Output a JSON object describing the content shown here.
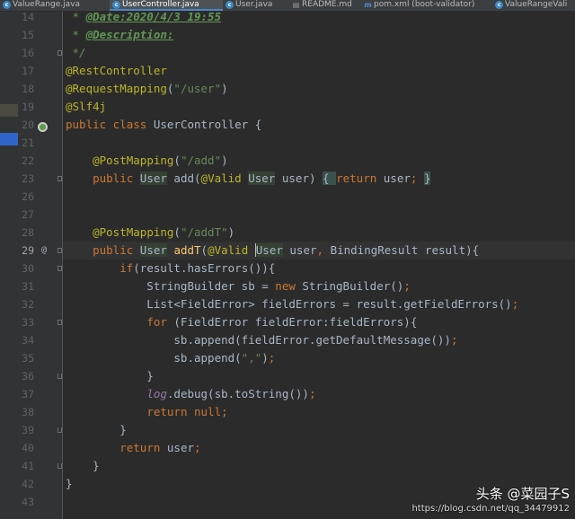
{
  "tabs": [
    {
      "label": "ValueRange.java",
      "icon": "class-icon"
    },
    {
      "label": "UserController.java",
      "icon": "class-icon",
      "active": true
    },
    {
      "label": "User.java",
      "icon": "class-icon"
    },
    {
      "label": "README.md",
      "icon": "markdown-icon"
    },
    {
      "label": "pom.xml (boot-validator)",
      "icon": "maven-icon"
    },
    {
      "label": "ValueRangeVali",
      "icon": "class-icon"
    }
  ],
  "gutter": {
    "line_numbers": [
      "14",
      "15",
      "16",
      "17",
      "18",
      "19",
      "20",
      "21",
      "22",
      "23",
      "26",
      "27",
      "28",
      "29",
      "30",
      "31",
      "32",
      "33",
      "34",
      "35",
      "36",
      "37",
      "38",
      "39",
      "40",
      "41",
      "42",
      "43"
    ],
    "current_line": "29",
    "override_marker": "@"
  },
  "code": {
    "l14": {
      "a": " * ",
      "b": "@Date:2020/4/3 19:55"
    },
    "l15": {
      "a": " * ",
      "b": "@Description:"
    },
    "l16": {
      "a": " */"
    },
    "l17": {
      "a": "@RestController"
    },
    "l18": {
      "a": "@RequestMapping",
      "b": "(",
      "c": "\"/user\"",
      "d": ")"
    },
    "l19": {
      "a": "@Slf4j"
    },
    "l20": {
      "a": "public class ",
      "b": "UserController {"
    },
    "l22": {
      "a": "    ",
      "b": "@PostMapping",
      "c": "(",
      "d": "\"/add\"",
      "e": ")"
    },
    "l23": {
      "a": "    ",
      "b": "public ",
      "c": "User",
      "d": " add(",
      "e": "@Valid ",
      "f": "User",
      "g": " user) ",
      "h": "{ ",
      "i": "return ",
      "j": "user",
      "k": "; ",
      "l": "}"
    },
    "l28": {
      "a": "    ",
      "b": "@PostMapping",
      "c": "(",
      "d": "\"/addT\"",
      "e": ")"
    },
    "l29": {
      "a": "    ",
      "b": "public ",
      "c": "User",
      "d": " ",
      "e": "addT",
      "f": "(",
      "g": "@Valid ",
      "h": "User",
      "i": " user",
      "j": ", ",
      "k": "BindingResult result){"
    },
    "l30": {
      "a": "        ",
      "b": "if",
      "c": "(result.hasErrors()){"
    },
    "l31": {
      "a": "            StringBuilder sb = ",
      "b": "new ",
      "c": "StringBuilder()",
      "d": ";"
    },
    "l32": {
      "a": "            List<FieldError> fieldErrors = result.getFieldErrors()",
      "b": ";"
    },
    "l33": {
      "a": "            ",
      "b": "for ",
      "c": "(FieldError fieldError:fieldErrors){"
    },
    "l34": {
      "a": "                sb.append(fieldError.getDefaultMessage())",
      "b": ";"
    },
    "l35": {
      "a": "                sb.append(",
      "b": "\",\"",
      "c": ")",
      "d": ";"
    },
    "l36": {
      "a": "            }"
    },
    "l37": {
      "a": "            ",
      "b": "log",
      "c": ".debug(sb.toString())",
      "d": ";"
    },
    "l38": {
      "a": "            ",
      "b": "return null",
      "c": ";"
    },
    "l39": {
      "a": "        }"
    },
    "l40": {
      "a": "        ",
      "b": "return ",
      "c": "user",
      "d": ";"
    },
    "l41": {
      "a": "    }"
    },
    "l42": {
      "a": "}"
    }
  },
  "watermark": {
    "url": "https://blog.csdn.net/qq_34479912",
    "brand": "头条 @菜园子S"
  },
  "colors": {
    "editor_bg": "#2b2b2b",
    "gutter_bg": "#313335",
    "keyword": "#cc7832",
    "annotation": "#bbb529",
    "string": "#6a8759",
    "comment": "#629755",
    "field": "#9876aa",
    "method": "#ffc66d"
  }
}
